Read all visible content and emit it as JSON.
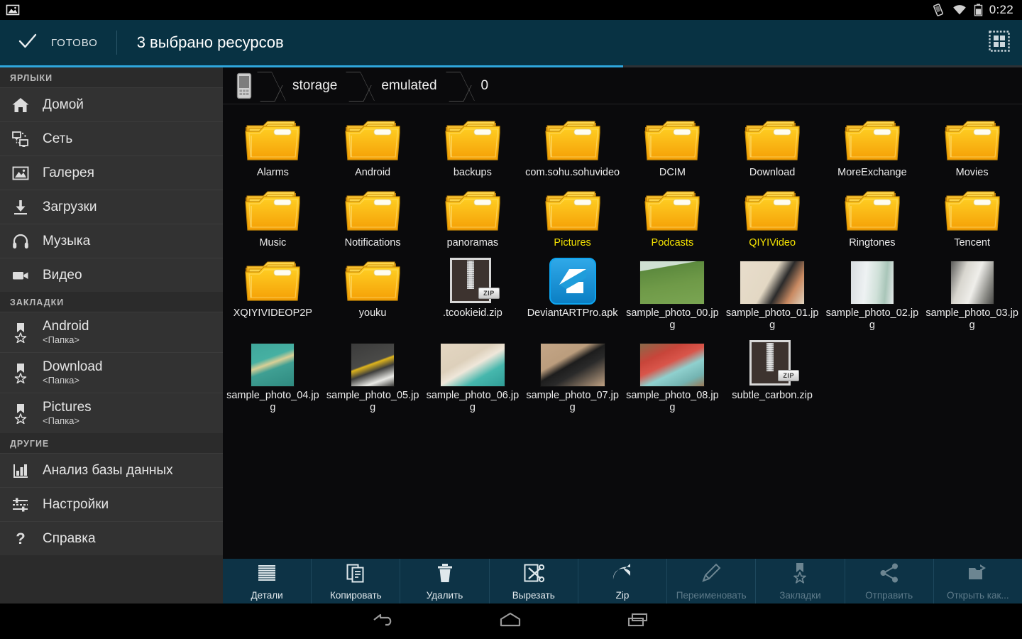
{
  "statusbar": {
    "clock": "0:22",
    "icons": [
      "vibrate-icon",
      "wifi-icon",
      "battery-icon"
    ]
  },
  "actionbar": {
    "done_label": "ГОТОВО",
    "title": "3 выбрано ресурсов",
    "view_toggle_icon": "grid-view-icon",
    "accent_color": "#2fa7dd",
    "background_color": "#083243"
  },
  "sidebar": {
    "sections": [
      {
        "title": "ЯРЛЫКИ",
        "items": [
          {
            "label": "Домой",
            "icon": "home-icon"
          },
          {
            "label": "Сеть",
            "icon": "network-icon"
          },
          {
            "label": "Галерея",
            "icon": "gallery-icon"
          },
          {
            "label": "Загрузки",
            "icon": "download-icon"
          },
          {
            "label": "Музыка",
            "icon": "headphones-icon"
          },
          {
            "label": "Видео",
            "icon": "videocam-icon"
          }
        ]
      },
      {
        "title": "ЗАКЛАДКИ",
        "items": [
          {
            "label": "Android",
            "sub": "<Папка>",
            "icon": "bookmark-star-icon"
          },
          {
            "label": "Download",
            "sub": "<Папка>",
            "icon": "bookmark-star-icon"
          },
          {
            "label": "Pictures",
            "sub": "<Папка>",
            "icon": "bookmark-star-icon"
          }
        ]
      },
      {
        "title": "ДРУГИЕ",
        "items": [
          {
            "label": "Анализ базы данных",
            "icon": "bar-chart-icon"
          },
          {
            "label": "Настройки",
            "icon": "sliders-icon"
          },
          {
            "label": "Справка",
            "icon": "question-mark-icon"
          }
        ]
      }
    ]
  },
  "breadcrumb": {
    "device_icon": "phone-icon",
    "crumbs": [
      "storage",
      "emulated",
      "0"
    ]
  },
  "files": [
    {
      "name": "Alarms",
      "type": "folder",
      "selected": false
    },
    {
      "name": "Android",
      "type": "folder",
      "selected": false
    },
    {
      "name": "backups",
      "type": "folder",
      "selected": false
    },
    {
      "name": "com.sohu.sohuvideo",
      "type": "folder",
      "selected": false
    },
    {
      "name": "DCIM",
      "type": "folder",
      "selected": false
    },
    {
      "name": "Download",
      "type": "folder",
      "selected": false
    },
    {
      "name": "MoreExchange",
      "type": "folder",
      "selected": false
    },
    {
      "name": "Movies",
      "type": "folder",
      "selected": false
    },
    {
      "name": "Music",
      "type": "folder",
      "selected": false
    },
    {
      "name": "Notifications",
      "type": "folder",
      "selected": false
    },
    {
      "name": "panoramas",
      "type": "folder",
      "selected": false
    },
    {
      "name": "Pictures",
      "type": "folder",
      "selected": true
    },
    {
      "name": "Podcasts",
      "type": "folder",
      "selected": true
    },
    {
      "name": "QIYIVideo",
      "type": "folder",
      "selected": true
    },
    {
      "name": "Ringtones",
      "type": "folder",
      "selected": false
    },
    {
      "name": "Tencent",
      "type": "folder",
      "selected": false
    },
    {
      "name": "XQIYIVIDEOP2P",
      "type": "folder",
      "selected": false
    },
    {
      "name": "youku",
      "type": "folder",
      "selected": false
    },
    {
      "name": ".tcookieid.zip",
      "type": "zip",
      "selected": false
    },
    {
      "name": "DeviantARTPro.apk",
      "type": "apk",
      "selected": false
    },
    {
      "name": "sample_photo_00.jpg",
      "type": "image",
      "selected": false,
      "thumb": "soccer-player-green-field"
    },
    {
      "name": "sample_photo_01.jpg",
      "type": "image",
      "selected": false,
      "thumb": "bicycle-wheel-beige"
    },
    {
      "name": "sample_photo_02.jpg",
      "type": "image",
      "selected": false,
      "thumb": "pale-glass-panel",
      "portrait": true
    },
    {
      "name": "sample_photo_03.jpg",
      "type": "image",
      "selected": false,
      "thumb": "number-three-pillar",
      "portrait": true
    },
    {
      "name": "sample_photo_04.jpg",
      "type": "image",
      "selected": false,
      "thumb": "teal-door-number-four",
      "portrait": true
    },
    {
      "name": "sample_photo_05.jpg",
      "type": "image",
      "selected": false,
      "thumb": "yellow-five-asphalt",
      "portrait": true
    },
    {
      "name": "sample_photo_06.jpg",
      "type": "image",
      "selected": false,
      "thumb": "poolside-legs"
    },
    {
      "name": "sample_photo_07.jpg",
      "type": "image",
      "selected": false,
      "thumb": "overhead-person-pavement"
    },
    {
      "name": "sample_photo_08.jpg",
      "type": "image",
      "selected": false,
      "thumb": "red-shoes-on-table"
    },
    {
      "name": "subtle_carbon.zip",
      "type": "zip",
      "selected": false
    }
  ],
  "toolbar": {
    "items": [
      {
        "label": "Детали",
        "icon": "details-lines-icon",
        "disabled": false
      },
      {
        "label": "Копировать",
        "icon": "copy-icon",
        "disabled": false
      },
      {
        "label": "Удалить",
        "icon": "trash-icon",
        "disabled": false
      },
      {
        "label": "Вырезать",
        "icon": "scissors-icon",
        "disabled": false
      },
      {
        "label": "Zip",
        "icon": "zip-arrow-icon",
        "disabled": false
      },
      {
        "label": "Переименовать",
        "icon": "pencil-icon",
        "disabled": true
      },
      {
        "label": "Закладки",
        "icon": "bookmark-star-icon",
        "disabled": true
      },
      {
        "label": "Отправить",
        "icon": "share-icon",
        "disabled": true
      },
      {
        "label": "Открыть как...",
        "icon": "open-as-folder-icon",
        "disabled": true
      }
    ]
  },
  "navbar": {
    "buttons": [
      "back-icon",
      "home-icon",
      "recents-icon"
    ]
  }
}
